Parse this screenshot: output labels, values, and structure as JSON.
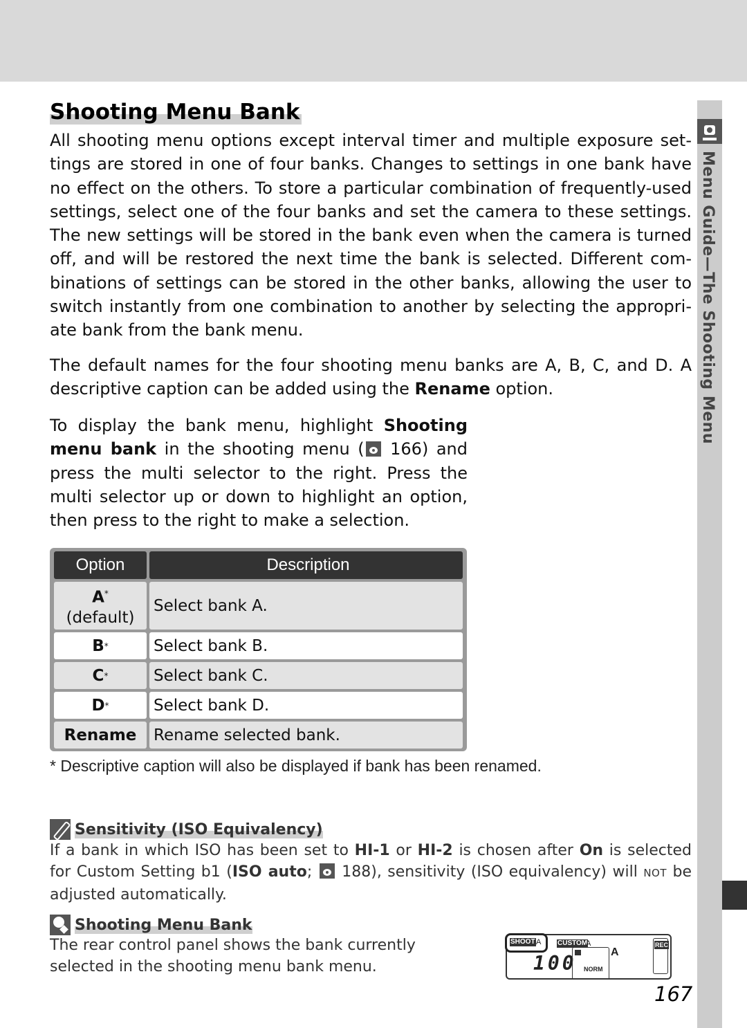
{
  "page": {
    "title": "Shooting Menu Bank",
    "side_tab_label": "Menu Guide—The Shooting Menu",
    "page_number": "167"
  },
  "intro": {
    "paragraph1": "All shooting menu options except interval timer and multiple exposure set-tings are stored in one of four banks.  Changes to settings in one bank have no effect on the others.  To store a particular combination of frequently-used settings, select one of the four banks and set the camera to these settings.  The new settings will be stored in the bank even when the camera is turned off, and will be restored the next time the bank is selected.  Different com-binations of settings can be stored in the other banks, allowing the user to switch instantly from one combination to another by selecting the appropri-ate bank from the bank menu.",
    "paragraph2_a": "The default names for the four shooting menu banks are A, B, C, and D.  A descriptive caption can be added using the ",
    "paragraph2_bold": "Rename",
    "paragraph2_b": " option.",
    "paragraph3_a": "To display the bank menu, highlight ",
    "paragraph3_bold1": "Shooting menu bank",
    "paragraph3_b": " in the shooting menu (",
    "paragraph3_ref": " 166) and press the multi selector to the right.  Press the multi selector up or down to highlight an option, then press to the right to make a selection."
  },
  "table": {
    "headers": [
      "Option",
      "Description"
    ],
    "rows": [
      {
        "option": "A",
        "sup": "*",
        "sub": "(default)",
        "description": "Select bank A."
      },
      {
        "option": "B",
        "sup": "*",
        "description": "Select bank B."
      },
      {
        "option": "C",
        "sup": "*",
        "description": "Select bank C."
      },
      {
        "option": "D",
        "sup": "*",
        "description": "Select bank D."
      },
      {
        "option": "Rename",
        "sup": "",
        "description": "Rename selected bank."
      }
    ],
    "footnote": "* Descriptive caption will also be displayed if bank has been renamed."
  },
  "notes": [
    {
      "icon": "pencil-icon",
      "heading": "Sensitivity (ISO Equivalency)",
      "t1": "If a bank in which ISO has been set to ",
      "b1": "HI-1",
      "t2": " or ",
      "b2": "HI-2",
      "t3": " is chosen after ",
      "b3": "On",
      "t4": " is selected for Custom Setting b1 (",
      "b4": "ISO auto",
      "t5": ";",
      "t6": " 188), sensitivity (ISO equivalency) will ",
      "sc": "NOT",
      "t7": " be adjusted automatically."
    },
    {
      "icon": "lightbulb-icon",
      "heading": "Shooting Menu Bank",
      "body": "The rear control panel shows the bank currently selected in the shooting menu bank menu."
    }
  ],
  "control_panel": {
    "shoot_label": "SHOOT",
    "shoot_bank": "A",
    "custom_label": "CUSTOM",
    "custom_bank": "A",
    "iso_value": "100",
    "quality": "NORM",
    "bank_letter": "A",
    "rec_label": "REC"
  }
}
